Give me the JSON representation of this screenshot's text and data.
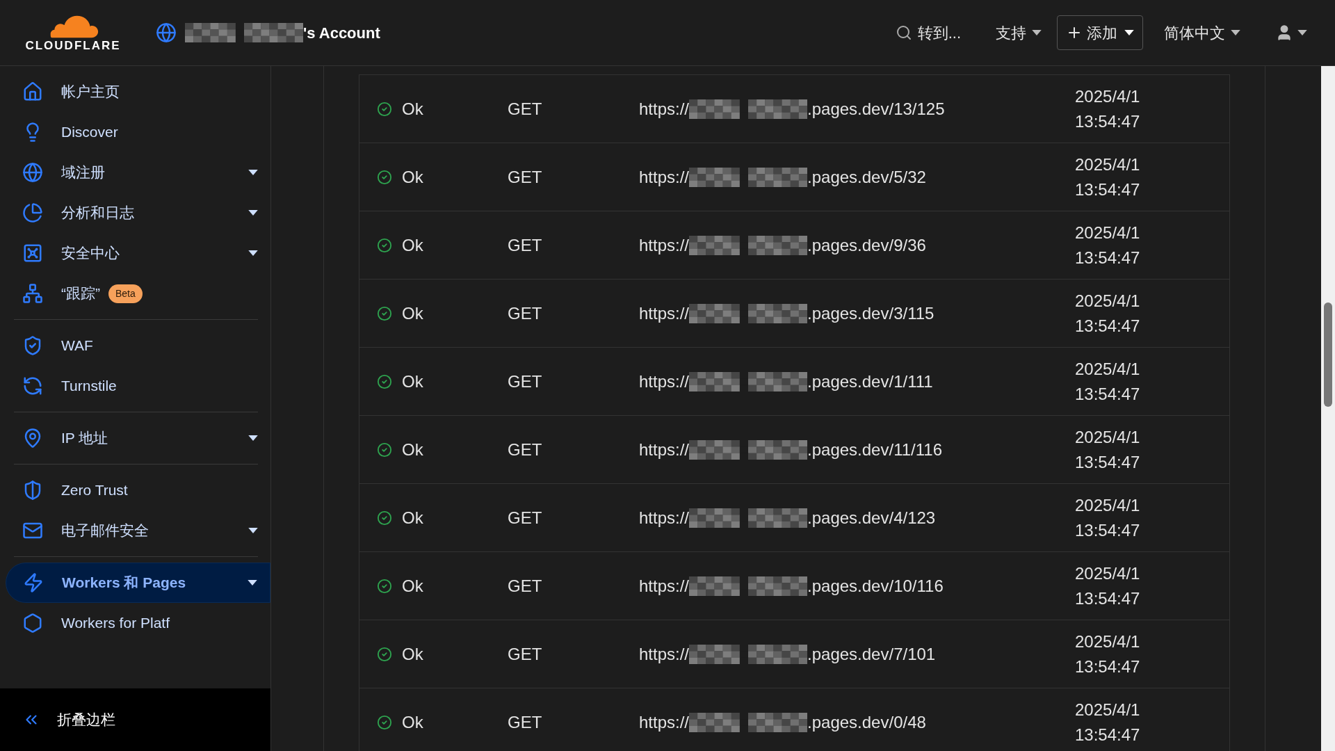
{
  "header": {
    "logo": "CLOUDFLARE",
    "account_suffix": "'s Account",
    "search": "转到...",
    "support": "支持",
    "add": "添加",
    "language": "简体中文"
  },
  "sidebar": {
    "groups": [
      [
        {
          "label": "帐户主页",
          "expandable": false,
          "selected": false
        },
        {
          "label": "Discover",
          "expandable": false,
          "selected": false
        },
        {
          "label": "域注册",
          "expandable": true,
          "selected": false
        },
        {
          "label": "分析和日志",
          "expandable": true,
          "selected": false
        },
        {
          "label": "安全中心",
          "expandable": true,
          "selected": false
        },
        {
          "label": "“跟踪”",
          "badge": "Beta",
          "expandable": false,
          "selected": false
        }
      ],
      [
        {
          "label": "WAF",
          "expandable": false,
          "selected": false
        },
        {
          "label": "Turnstile",
          "expandable": false,
          "selected": false
        }
      ],
      [
        {
          "label": "IP 地址",
          "expandable": true,
          "selected": false
        }
      ],
      [
        {
          "label": "Zero Trust",
          "expandable": false,
          "selected": false
        },
        {
          "label": "电子邮件安全",
          "expandable": true,
          "selected": false
        }
      ],
      [
        {
          "label": "Workers 和 Pages",
          "expandable": true,
          "selected": true
        },
        {
          "label": "Workers for Platf",
          "expandable": false,
          "selected": false
        }
      ]
    ],
    "collapse": "折叠边栏"
  },
  "table": {
    "rows": [
      {
        "status": "Ok",
        "method": "GET",
        "url_prefix": "https://",
        "url_suffix": ".pages.dev/13/125",
        "date": "2025/4/1",
        "time": "13:54:47"
      },
      {
        "status": "Ok",
        "method": "GET",
        "url_prefix": "https://",
        "url_suffix": ".pages.dev/5/32",
        "date": "2025/4/1",
        "time": "13:54:47"
      },
      {
        "status": "Ok",
        "method": "GET",
        "url_prefix": "https://",
        "url_suffix": ".pages.dev/9/36",
        "date": "2025/4/1",
        "time": "13:54:47"
      },
      {
        "status": "Ok",
        "method": "GET",
        "url_prefix": "https://",
        "url_suffix": ".pages.dev/3/115",
        "date": "2025/4/1",
        "time": "13:54:47"
      },
      {
        "status": "Ok",
        "method": "GET",
        "url_prefix": "https://",
        "url_suffix": ".pages.dev/1/111",
        "date": "2025/4/1",
        "time": "13:54:47"
      },
      {
        "status": "Ok",
        "method": "GET",
        "url_prefix": "https://",
        "url_suffix": ".pages.dev/11/116",
        "date": "2025/4/1",
        "time": "13:54:47"
      },
      {
        "status": "Ok",
        "method": "GET",
        "url_prefix": "https://",
        "url_suffix": ".pages.dev/4/123",
        "date": "2025/4/1",
        "time": "13:54:47"
      },
      {
        "status": "Ok",
        "method": "GET",
        "url_prefix": "https://",
        "url_suffix": ".pages.dev/10/116",
        "date": "2025/4/1",
        "time": "13:54:47"
      },
      {
        "status": "Ok",
        "method": "GET",
        "url_prefix": "https://",
        "url_suffix": ".pages.dev/7/101",
        "date": "2025/4/1",
        "time": "13:54:47"
      },
      {
        "status": "Ok",
        "method": "GET",
        "url_prefix": "https://",
        "url_suffix": ".pages.dev/0/48",
        "date": "2025/4/1",
        "time": "13:54:47"
      }
    ]
  }
}
